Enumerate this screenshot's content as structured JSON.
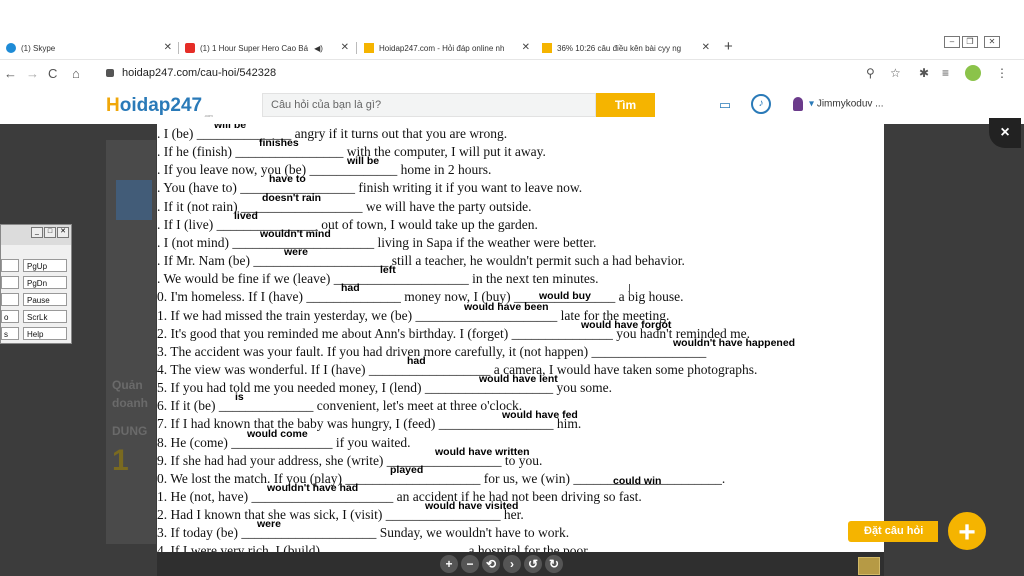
{
  "browser": {
    "tabs": [
      {
        "label": "(1) Skype",
        "fav_color": "#1e8bd6",
        "left": 0
      },
      {
        "label": "(1) 1 Hour Super Hero Cao Bá",
        "fav_color": "#e52d27",
        "left": 0
      },
      {
        "label": "Hoidap247.com - Hỏi đáp online nh",
        "fav_color": "#f5b400",
        "left": 0
      },
      {
        "label": "36% 10:26 câu điều kên bài cyy ng",
        "fav_color": "#f5b400",
        "left": 0
      }
    ],
    "new_tab": "+",
    "url": "hoidap247.com/cau-hoi/542328"
  },
  "site": {
    "logo_main": "oidap247",
    "logo_h": "H",
    "logo_sub": ".com",
    "search_placeholder": "Câu hỏi của bạn là gì?",
    "search_button": "Tìm",
    "username": "Jimmykoduv ..."
  },
  "osk": {
    "keys": [
      "PgUp",
      "PgDn",
      "Pause",
      "ScrLk",
      "Help"
    ],
    "left_keys": [
      "",
      "",
      "",
      "o",
      "s"
    ]
  },
  "background_text": {
    "line1": "Quản",
    "line2": "doanh",
    "line3": "DUNG"
  },
  "document": {
    "lines": [
      {
        "text": ". I (be) ______________ angry if it turns out that you are wrong.",
        "answer": "will be"
      },
      {
        "text": ". If he (finish) ________________ with the computer, I will put it away.",
        "answer": "finishes"
      },
      {
        "text": ". If you leave now, you (be) _____________ home in 2 hours.",
        "answer": "will be"
      },
      {
        "text": ". You (have to) _________________ finish writing it if you want to leave now.",
        "answer": "have to"
      },
      {
        "text": ". If it (not rain) __________________ we will have the party outside.",
        "answer": "doesn't rain"
      },
      {
        "text": ". If I (live) _______________ out of town, I would take up the garden.",
        "answer": "lived"
      },
      {
        "text": ". I (not mind) _____________________ living in Sapa if the weather were better.",
        "answer": "wouldn't mind"
      },
      {
        "text": ". If Mr. Nam (be) ____________________ still a teacher, he wouldn't permit such a had behavior.",
        "answer": "were"
      },
      {
        "text": ". We would be fine if we (leave) ____________________ in the next ten minutes.",
        "answer": "left"
      },
      {
        "text": "0. I'm homeless. If I (have) ______________ money now, I (buy) _______________ a big house.",
        "answer": "had"
      },
      {
        "text": "1. If we had missed the train yesterday, we (be) _____________________ late for the meeting.",
        "answer": "would have been"
      },
      {
        "text": "2. It's good that you reminded me about Ann's birthday. I (forget) _______________ you hadn't reminded me.",
        "answer": "would have forgot"
      },
      {
        "text": "3. The accident was your fault. If you had driven more carefully, it (not happen) _________________",
        "answer": "wouldn't have happened"
      },
      {
        "text": "4. The view was wonderful. If I (have) __________________ a camera, I would have taken some photographs.",
        "answer": "had"
      },
      {
        "text": "5. If you had told me you needed money, I (lend) ___________________ you some.",
        "answer": "would have lent"
      },
      {
        "text": "6. If it (be) ______________ convenient, let's meet at three o'clock.",
        "answer": "is"
      },
      {
        "text": "7. If I had known that the baby was hungry, I (feed) _________________ him.",
        "answer": "would have fed"
      },
      {
        "text": "8. He (come) _______________ if you waited.",
        "answer": "would come"
      },
      {
        "text": "9. If she had had your address, she (write) _________________ to you.",
        "answer": "would have written"
      },
      {
        "text": "0. We lost the match. If you (play) ____________________ for us, we (win) ______________________.",
        "answer": "played"
      },
      {
        "text": "1. He (not, have) _____________________ an accident if he had not been driving so fast.",
        "answer": "wouldn't have had"
      },
      {
        "text": "2. Had I known that she was sick, I (visit) _________________ her.",
        "answer": "would have visited"
      },
      {
        "text": "3. If today (be) ____________________ Sunday, we wouldn't have to work.",
        "answer": "were"
      },
      {
        "text": "4. If I were very rich, I (build) _____________________ a hospital for the poor.",
        "answer": ""
      }
    ],
    "extra_answers": [
      {
        "text": "would buy"
      },
      {
        "text": "could win"
      }
    ]
  },
  "toolbar_icons": [
    "+",
    "−",
    "⟲",
    "›",
    "↺",
    "↻"
  ],
  "ask_button": "Đặt câu hỏi",
  "ask_plus": "+",
  "close_overlay": "×"
}
